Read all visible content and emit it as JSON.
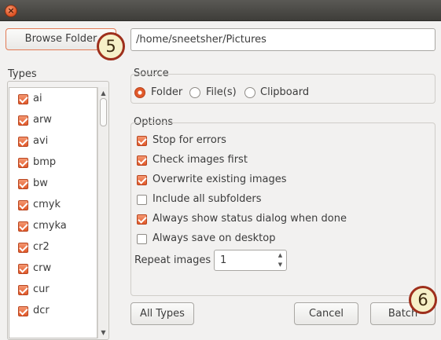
{
  "window": {
    "close_icon": "close-icon",
    "close_glyph": "×"
  },
  "browse": {
    "label": "Browse Folder",
    "badge": "5"
  },
  "path": {
    "value": "/home/sneetsher/Pictures"
  },
  "types": {
    "title": "Types",
    "items": [
      {
        "label": "ai",
        "checked": true
      },
      {
        "label": "arw",
        "checked": true
      },
      {
        "label": "avi",
        "checked": true
      },
      {
        "label": "bmp",
        "checked": true
      },
      {
        "label": "bw",
        "checked": true
      },
      {
        "label": "cmyk",
        "checked": true
      },
      {
        "label": "cmyka",
        "checked": true
      },
      {
        "label": "cr2",
        "checked": true
      },
      {
        "label": "crw",
        "checked": true
      },
      {
        "label": "cur",
        "checked": true
      },
      {
        "label": "dcr",
        "checked": true
      }
    ]
  },
  "source": {
    "title": "Source",
    "options": [
      {
        "label": "Folder",
        "selected": true
      },
      {
        "label": "File(s)",
        "selected": false
      },
      {
        "label": "Clipboard",
        "selected": false
      }
    ]
  },
  "options": {
    "title": "Options",
    "items": [
      {
        "label": "Stop for errors",
        "checked": true
      },
      {
        "label": "Check images first",
        "checked": true
      },
      {
        "label": "Overwrite existing images",
        "checked": true
      },
      {
        "label": "Include all subfolders",
        "checked": false
      },
      {
        "label": "Always show status dialog when done",
        "checked": true
      },
      {
        "label": "Always save on desktop",
        "checked": false
      }
    ],
    "repeat_label": "Repeat images",
    "repeat_value": "1"
  },
  "buttons": {
    "all_types": "All Types",
    "cancel": "Cancel",
    "batch": "Batch",
    "batch_badge": "6"
  },
  "colors": {
    "accent": "#e1592a",
    "badge_ring": "#9e2f1c",
    "badge_fill": "#f6f0c8"
  }
}
